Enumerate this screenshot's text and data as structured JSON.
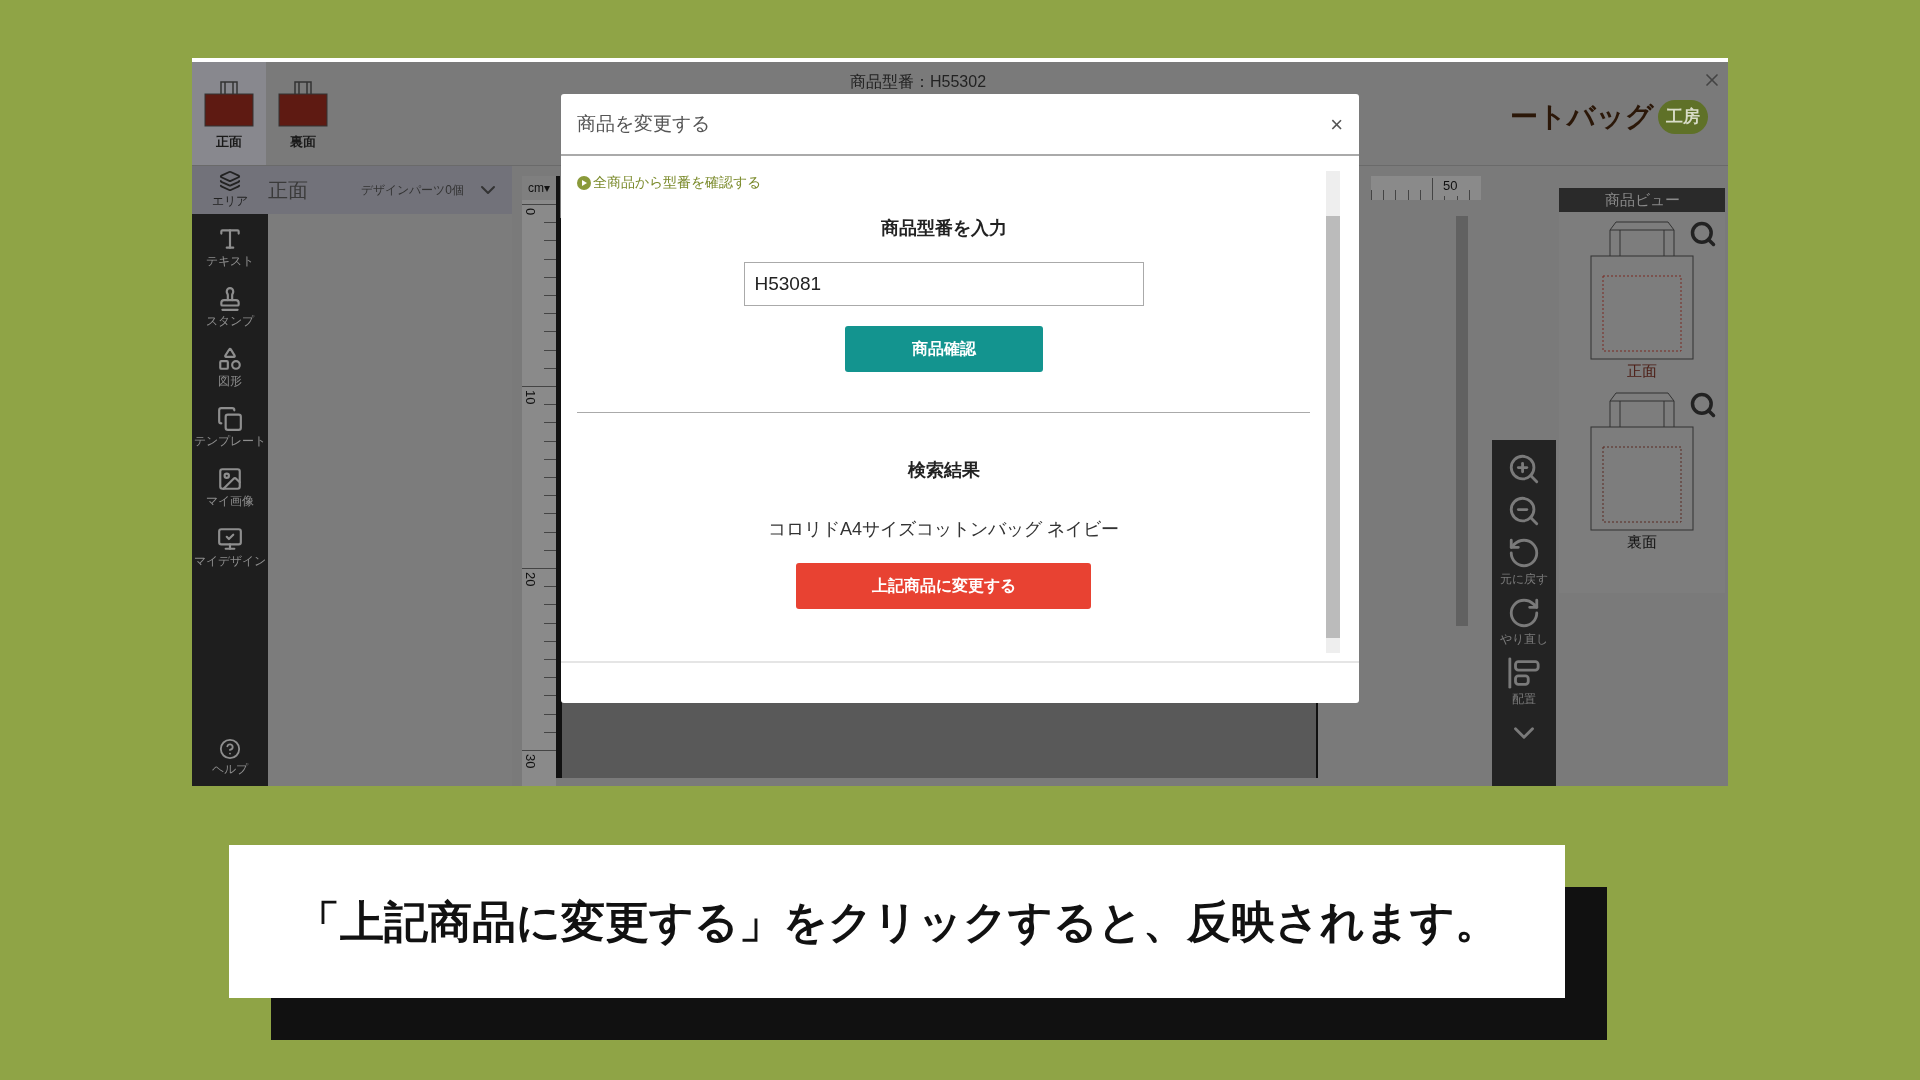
{
  "screen": {
    "product_tabs": [
      {
        "label": "正面",
        "selected": true
      },
      {
        "label": "裏面",
        "selected": false
      }
    ],
    "model_number": "商品型番：H55302",
    "logo": {
      "text": "ートバッグ",
      "badge": "工房"
    },
    "area_panel": {
      "icon_label": "エリア",
      "title": "正面",
      "parts_count": "デザインパーツ0個"
    },
    "tools": [
      {
        "kind": "text",
        "label": "テキスト"
      },
      {
        "kind": "stamp",
        "label": "スタンプ"
      },
      {
        "kind": "shape",
        "label": "図形"
      },
      {
        "kind": "template",
        "label": "テンプレート"
      },
      {
        "kind": "image",
        "label": "マイ画像"
      },
      {
        "kind": "design",
        "label": "マイデザイン"
      }
    ],
    "help": "ヘルプ",
    "ruler": {
      "unit": "cm",
      "unit_caret": "▾",
      "marks": [
        "0",
        "10",
        "20",
        "30"
      ],
      "top_mark": "50"
    },
    "product_view": {
      "title": "商品ビュー",
      "views": [
        {
          "label": "正面",
          "selected": true
        },
        {
          "label": "裏面",
          "selected": false
        }
      ]
    },
    "view_tools": [
      {
        "kind": "zoom-in"
      },
      {
        "kind": "zoom-out"
      },
      {
        "kind": "undo",
        "label": "元に戻す"
      },
      {
        "kind": "redo",
        "label": "やり直し"
      },
      {
        "kind": "align",
        "label": "配置"
      },
      {
        "kind": "more"
      }
    ]
  },
  "dialog": {
    "title": "商品を変更する",
    "close": "×",
    "link": "全商品から型番を確認する",
    "input_heading": "商品型番を入力",
    "input_value": "H53081",
    "confirm_button": "商品確認",
    "result_heading": "検索結果",
    "result_name": "コロリドA4サイズコットンバッグ ネイビー",
    "change_button": "上記商品に変更する"
  },
  "caption": "「上記商品に変更する」をクリックすると、反映されます。"
}
